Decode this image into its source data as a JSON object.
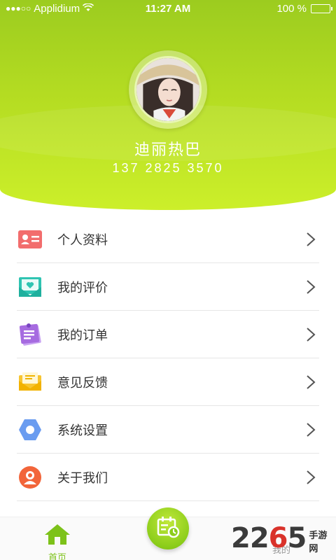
{
  "status_bar": {
    "signal": "●●●○○",
    "carrier": "Applidium",
    "time": "11:27 AM",
    "battery_text": "100 %"
  },
  "profile": {
    "name": "迪丽热巴",
    "phone": "137 2825 3570"
  },
  "menu": [
    {
      "label": "个人资料",
      "icon": "id-card-icon",
      "color": "#f26d6d"
    },
    {
      "label": "我的评价",
      "icon": "heart-envelope-icon",
      "color": "#2fc4b2"
    },
    {
      "label": "我的订单",
      "icon": "notepad-icon",
      "color": "#a66be0"
    },
    {
      "label": "意见反馈",
      "icon": "mail-icon",
      "color": "#f7c531"
    },
    {
      "label": "系统设置",
      "icon": "hexagon-settings-icon",
      "color": "#6a9cf0"
    },
    {
      "label": "关于我们",
      "icon": "user-circle-icon",
      "color": "#f2653a"
    }
  ],
  "tabbar": {
    "home_label": "首页",
    "mine_label": "我的"
  },
  "watermark": {
    "number_a": "22",
    "number_b": "6",
    "number_c": "5",
    "site": "手游网"
  },
  "colors": {
    "accent": "#8ccd1a",
    "header_top": "#9ccc1f",
    "header_bottom": "#ccef2a"
  }
}
